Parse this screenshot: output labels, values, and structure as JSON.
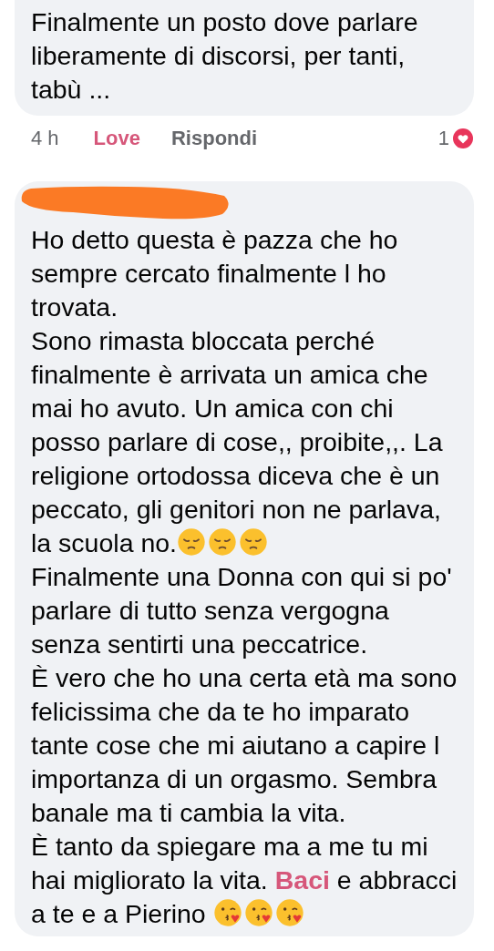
{
  "comments": [
    {
      "text": "Finalmente un posto dove parlare liberamente di discorsi, per tanti, tabù ...",
      "time": "4 h",
      "reaction_label": "Love",
      "reacted": true,
      "reply_label": "Rispondi",
      "reaction_count": "1"
    },
    {
      "author_redacted": true,
      "paragraphs": [
        [
          {
            "kind": "text",
            "text": "Ho detto questa è pazza che ho sempre cercato finalmente l ho trovata."
          }
        ],
        [
          {
            "kind": "text",
            "text": "Sono rimasta bloccata perché finalmente è arrivata un amica che mai ho avuto. Un amica con chi posso parlare di cose,, proibite,,. La religione ortodossa diceva che è un peccato, gli genitori non ne parlava, la scuola no."
          },
          {
            "kind": "pensive_emoji"
          },
          {
            "kind": "pensive_emoji"
          },
          {
            "kind": "pensive_emoji"
          }
        ],
        [
          {
            "kind": "text",
            "text": "Finalmente una Donna con qui si po' parlare di tutto senza vergogna senza sentirti una peccatrice."
          }
        ],
        [
          {
            "kind": "text",
            "text": "È vero che ho una certa età ma sono felicissima che da te ho imparato tante cose che mi aiutano a capire l importanza di un orgasmo. Sembra banale ma ti cambia la vita."
          }
        ],
        [
          {
            "kind": "text",
            "text": "È tanto da spiegare ma a me tu mi hai migliorato la vita. "
          },
          {
            "kind": "link",
            "text": "Baci"
          },
          {
            "kind": "text",
            "text": " e abbracci a te e a Pierino "
          },
          {
            "kind": "kiss_emoji"
          },
          {
            "kind": "kiss_emoji"
          },
          {
            "kind": "kiss_emoji"
          }
        ]
      ]
    }
  ]
}
